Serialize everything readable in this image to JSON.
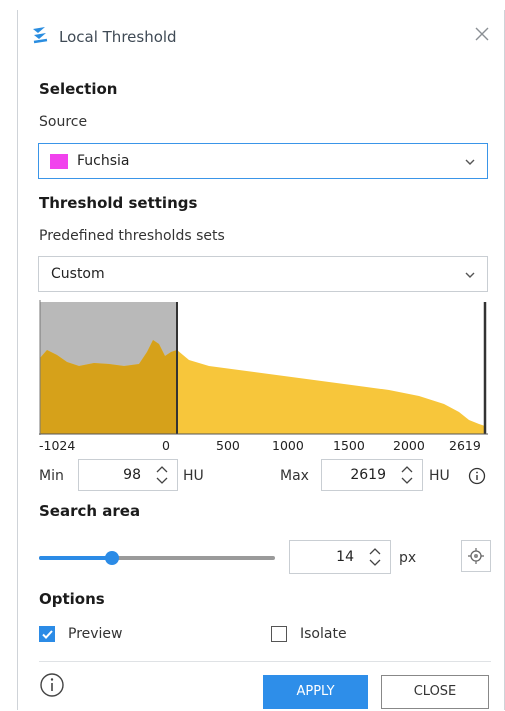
{
  "window": {
    "title": "Local Threshold"
  },
  "selection": {
    "heading": "Selection",
    "source_label": "Source",
    "source_value": "Fuchsia",
    "source_color": "#f142ed"
  },
  "threshold": {
    "heading": "Threshold settings",
    "preset_label": "Predefined thresholds sets",
    "preset_value": "Custom",
    "axis_ticks": [
      "-1024",
      "0",
      "500",
      "1000",
      "1500",
      "2000",
      "2619"
    ],
    "min_label": "Min",
    "min_value": "98",
    "min_unit": "HU",
    "max_label": "Max",
    "max_value": "2619",
    "max_unit": "HU"
  },
  "search_area": {
    "heading": "Search area",
    "slider_level": 0.3,
    "value": "14",
    "unit": "px"
  },
  "options": {
    "heading": "Options",
    "preview_label": "Preview",
    "preview_checked": true,
    "isolate_label": "Isolate",
    "isolate_checked": false
  },
  "buttons": {
    "apply": "APPLY",
    "close": "CLOSE"
  },
  "colors": {
    "accent": "#2e8ee9",
    "histogram_fill": "#f7c63b",
    "selection_shade": "#b8b8b8"
  }
}
